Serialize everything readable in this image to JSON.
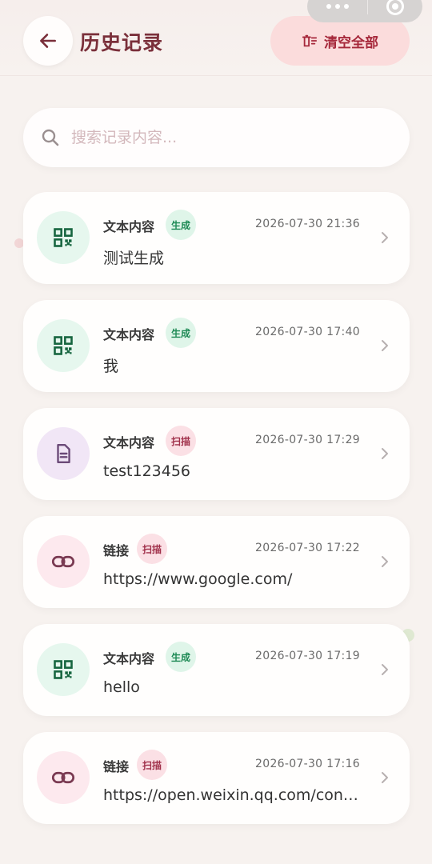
{
  "header": {
    "title": "历史记录",
    "clear_label": "清空全部"
  },
  "search": {
    "placeholder": "搜索记录内容..."
  },
  "records": [
    {
      "type": "文本内容",
      "badge": "生成",
      "badge_kind": "gen",
      "icon": "qr-code-icon",
      "time": "2026-07-30 21:36",
      "content": "测试生成"
    },
    {
      "type": "文本内容",
      "badge": "生成",
      "badge_kind": "gen",
      "icon": "qr-code-icon",
      "time": "2026-07-30 17:40",
      "content": "我"
    },
    {
      "type": "文本内容",
      "badge": "扫描",
      "badge_kind": "scan",
      "icon": "document-icon",
      "time": "2026-07-30 17:29",
      "content": "test123456"
    },
    {
      "type": "链接",
      "badge": "扫描",
      "badge_kind": "scan",
      "icon": "link-icon",
      "time": "2026-07-30 17:22",
      "content": "https://www.google.com/"
    },
    {
      "type": "文本内容",
      "badge": "生成",
      "badge_kind": "gen",
      "icon": "qr-code-icon",
      "time": "2026-07-30 17:19",
      "content": "hello"
    },
    {
      "type": "链接",
      "badge": "扫描",
      "badge_kind": "scan",
      "icon": "link-icon",
      "time": "2026-07-30 17:16",
      "content": "https://open.weixin.qq.com/con…"
    }
  ],
  "colors": {
    "accent": "#7a2f3a",
    "clear_bg": "#fbdcdc",
    "clear_text": "#a6283b",
    "gen_green": "#1e8a55",
    "scan_red": "#a0304a",
    "background": "#f7f2ef"
  }
}
